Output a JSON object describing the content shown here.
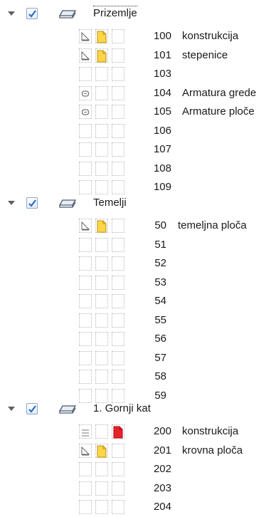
{
  "groups": [
    {
      "name": "Prizemlje",
      "checked": true,
      "items": [
        {
          "number": "100",
          "label": "konstrukcija",
          "icons": [
            "triangle-icon",
            "note-yellow-icon",
            ""
          ]
        },
        {
          "number": "101",
          "label": "stepenice",
          "icons": [
            "triangle-icon",
            "note-yellow-icon",
            ""
          ]
        },
        {
          "number": "103",
          "label": "",
          "icons": [
            "",
            "",
            ""
          ]
        },
        {
          "number": "104",
          "label": "Armatura grede",
          "icons": [
            "link-icon",
            "",
            ""
          ]
        },
        {
          "number": "105",
          "label": "Armature ploče",
          "icons": [
            "link-icon",
            "",
            ""
          ]
        },
        {
          "number": "106",
          "label": "",
          "icons": [
            "",
            "",
            ""
          ]
        },
        {
          "number": "107",
          "label": "",
          "icons": [
            "",
            "",
            ""
          ]
        },
        {
          "number": "108",
          "label": "",
          "icons": [
            "",
            "",
            ""
          ]
        },
        {
          "number": "109",
          "label": "",
          "icons": [
            "",
            "",
            ""
          ]
        }
      ]
    },
    {
      "name": "Temelji",
      "checked": true,
      "items": [
        {
          "number": "50",
          "label": "temeljna ploča",
          "icons": [
            "triangle-icon",
            "note-yellow-icon",
            ""
          ]
        },
        {
          "number": "51",
          "label": "",
          "icons": [
            "",
            "",
            ""
          ]
        },
        {
          "number": "52",
          "label": "",
          "icons": [
            "",
            "",
            ""
          ]
        },
        {
          "number": "53",
          "label": "",
          "icons": [
            "",
            "",
            ""
          ]
        },
        {
          "number": "54",
          "label": "",
          "icons": [
            "",
            "",
            ""
          ]
        },
        {
          "number": "55",
          "label": "",
          "icons": [
            "",
            "",
            ""
          ]
        },
        {
          "number": "56",
          "label": "",
          "icons": [
            "",
            "",
            ""
          ]
        },
        {
          "number": "57",
          "label": "",
          "icons": [
            "",
            "",
            ""
          ]
        },
        {
          "number": "58",
          "label": "",
          "icons": [
            "",
            "",
            ""
          ]
        },
        {
          "number": "59",
          "label": "",
          "icons": [
            "",
            "",
            ""
          ]
        }
      ]
    },
    {
      "name": "1. Gornji kat",
      "checked": true,
      "items": [
        {
          "number": "200",
          "label": "konstrukcija",
          "icons": [
            "lines-icon",
            "",
            "note-red-icon"
          ]
        },
        {
          "number": "201",
          "label": "krovna ploča",
          "icons": [
            "triangle-icon",
            "note-yellow-icon",
            ""
          ]
        },
        {
          "number": "202",
          "label": "",
          "icons": [
            "",
            "",
            ""
          ]
        },
        {
          "number": "203",
          "label": "",
          "icons": [
            "",
            "",
            ""
          ]
        },
        {
          "number": "204",
          "label": "",
          "icons": [
            "",
            "",
            ""
          ]
        }
      ]
    }
  ],
  "colors": {
    "note_yellow": "#ffd54a",
    "note_red": "#e8202a",
    "checkbox_tick": "#2c6cc8"
  }
}
